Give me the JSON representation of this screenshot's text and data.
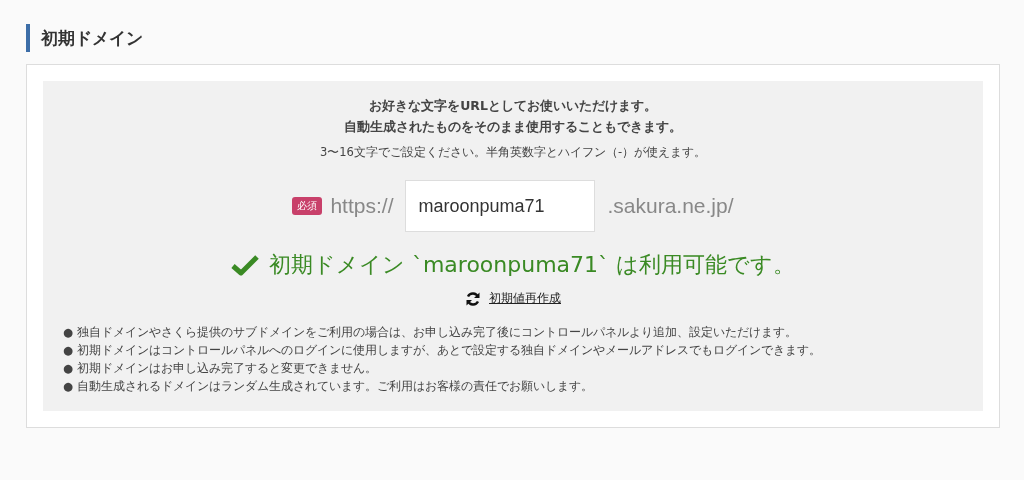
{
  "heading": "初期ドメイン",
  "intro": [
    "お好きな文字をURLとしてお使いいただけます。",
    "自動生成されたものをそのまま使用することもできます。"
  ],
  "hint": "3〜16文字でご設定ください。半角英数字とハイフン（-）が使えます。",
  "domain_field": {
    "required_badge": "必須",
    "prefix": "https://",
    "value": "maroonpuma71",
    "suffix": ".sakura.ne.jp/"
  },
  "status": {
    "kind": "available",
    "text": "初期ドメイン `maroonpuma71` は利用可能です。"
  },
  "regenerate_link": "初期値再作成",
  "notes": [
    "● 独自ドメインやさくら提供のサブドメインをご利用の場合は、お申し込み完了後にコントロールパネルより追加、設定いただけます。",
    "● 初期ドメインはコントロールパネルへのログインに使用しますが、あとで設定する独自ドメインやメールアドレスでもログインできます。",
    "● 初期ドメインはお申し込み完了すると変更できません。",
    "● 自動生成されるドメインはランダム生成されています。ご利用はお客様の責任でお願いします。"
  ]
}
